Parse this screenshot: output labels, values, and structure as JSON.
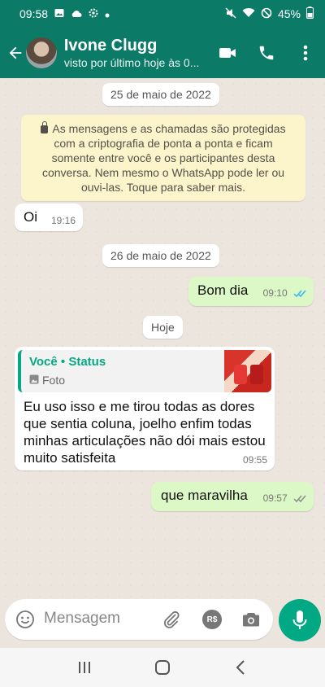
{
  "status_bar": {
    "time": "09:58",
    "battery": "45%"
  },
  "header": {
    "contact_name": "Ivone Clugg",
    "last_seen": "visto por último hoje às 0..."
  },
  "messages": {
    "date1": "25 de maio de 2022",
    "encryption_notice": "As mensagens e as chamadas são protegidas com a criptografia de ponta a ponta e ficam somente entre você e os participantes desta conversa. Nem mesmo o WhatsApp pode ler ou ouvi-las. Toque para saber mais.",
    "msg1": {
      "text": "Oi",
      "time": "19:16"
    },
    "date2": "26 de maio de 2022",
    "msg2": {
      "text": "Bom dia",
      "time": "09:10"
    },
    "date3": "Hoje",
    "msg3": {
      "reply_title": "Você • Status",
      "reply_media": "Foto",
      "text": "Eu uso isso e me tirou todas as dores que sentia coluna, joelho enfim todas minhas articulações não dói mais estou muito satisfeita",
      "time": "09:55"
    },
    "msg4": {
      "text": "que maravilha",
      "time": "09:57"
    }
  },
  "composer": {
    "placeholder": "Mensagem",
    "payment_label": "R$"
  },
  "icons": {
    "status_bar": [
      "image-icon",
      "cloud-icon",
      "settings-icon",
      "dot-icon",
      "mute-icon",
      "wifi-icon",
      "do-not-disturb-icon",
      "battery-icon"
    ],
    "header": [
      "back-arrow-icon",
      "video-call-icon",
      "phone-icon",
      "more-vert-icon"
    ],
    "composer": [
      "emoji-icon",
      "attach-icon",
      "payment-icon",
      "camera-icon",
      "mic-icon"
    ],
    "nav": [
      "recent-apps-icon",
      "home-icon",
      "back-icon"
    ]
  },
  "colors": {
    "header": "#0b7a66",
    "accent": "#00a884",
    "outgoing_bubble": "#dcf8c6",
    "read_ticks": "#34b7f1",
    "delivered_ticks": "#8c8c8c",
    "notice_bg": "#fcf4cb"
  }
}
